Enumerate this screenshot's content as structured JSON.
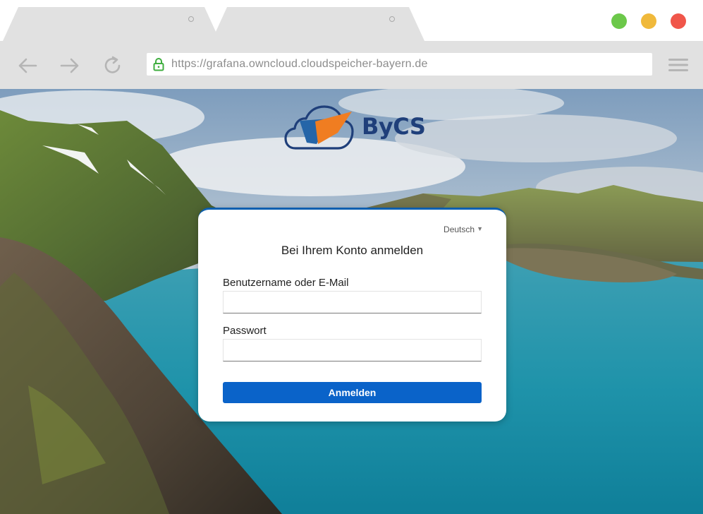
{
  "browser": {
    "tabs": [
      {
        "label": ""
      },
      {
        "label": ""
      }
    ],
    "url": "https://grafana.owncloud.cloudspeicher-bayern.de",
    "window_buttons": [
      "green",
      "yellow",
      "red"
    ],
    "icons": {
      "back": "arrow-left-icon",
      "forward": "arrow-right-icon",
      "reload": "reload-icon",
      "lock": "lock-icon",
      "menu": "hamburger-menu-icon"
    }
  },
  "brand": {
    "name": "ByCS",
    "logo_icon": "cloud-logo-icon",
    "colors": {
      "navy": "#1f3f7a",
      "orange": "#f07d21",
      "blue": "#2565a8"
    }
  },
  "login": {
    "language": "Deutsch",
    "title": "Bei Ihrem Konto anmelden",
    "username_label": "Benutzername oder E-Mail",
    "username_value": "",
    "password_label": "Passwort",
    "password_value": "",
    "submit_label": "Anmelden",
    "colors": {
      "button": "#0a63c9",
      "card_top_border": "#0b5fb0"
    }
  }
}
